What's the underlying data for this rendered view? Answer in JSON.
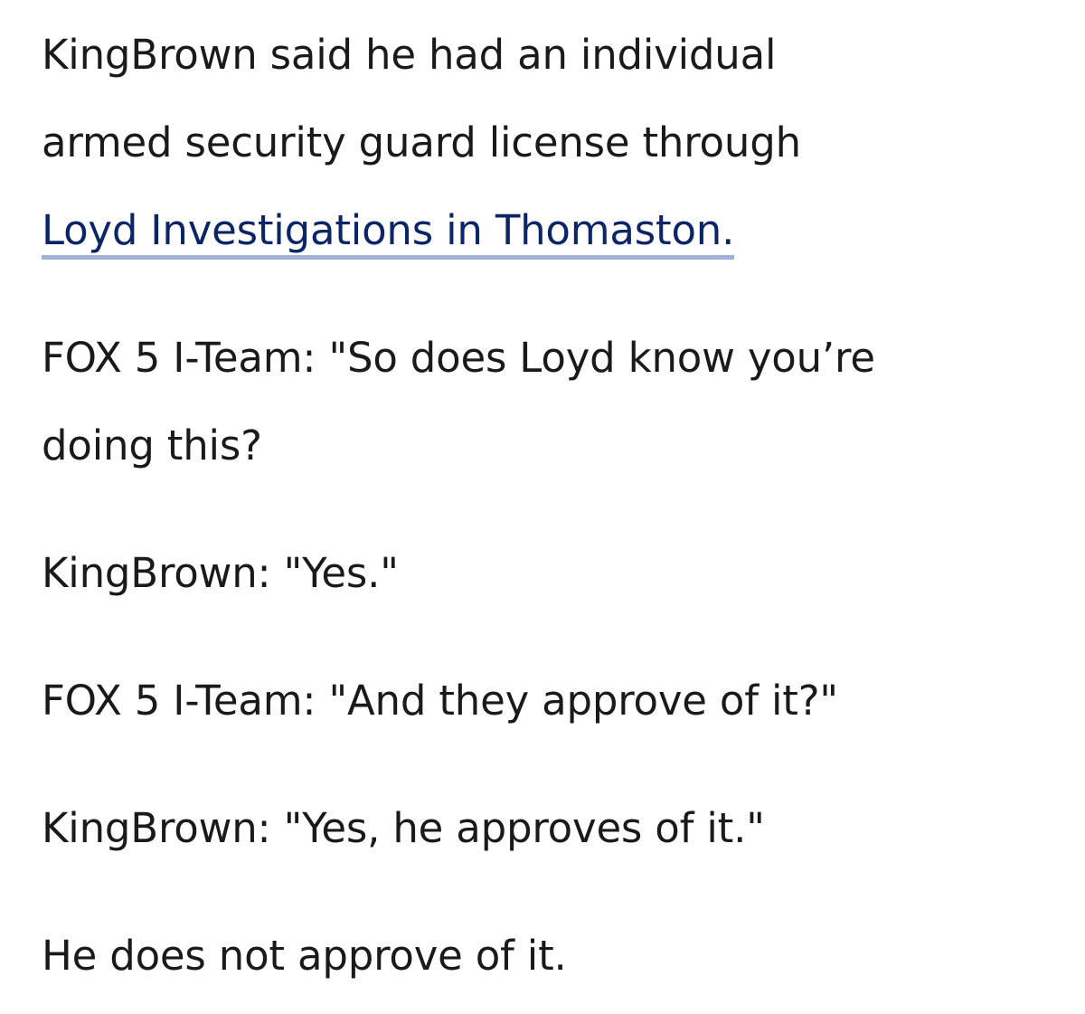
{
  "article": {
    "intro": {
      "line1": "KingBrown said he had an individual",
      "line2": "armed security guard license through",
      "link_text": "Loyd Investigations in Thomaston."
    },
    "q1": {
      "line1": "FOX 5 I-Team: \"So does Loyd know you’re",
      "line2": "doing this?"
    },
    "a1": "KingBrown: \"Yes.\"",
    "q2": "FOX 5 I-Team: \"And they approve of it?\"",
    "a2": "KingBrown: \"Yes, he approves of it.\"",
    "closing": "He does not approve of it."
  },
  "colors": {
    "text": "#1a1a1a",
    "link": "#0b2566",
    "link_underline": "#a3b0d9",
    "background": "#ffffff"
  }
}
